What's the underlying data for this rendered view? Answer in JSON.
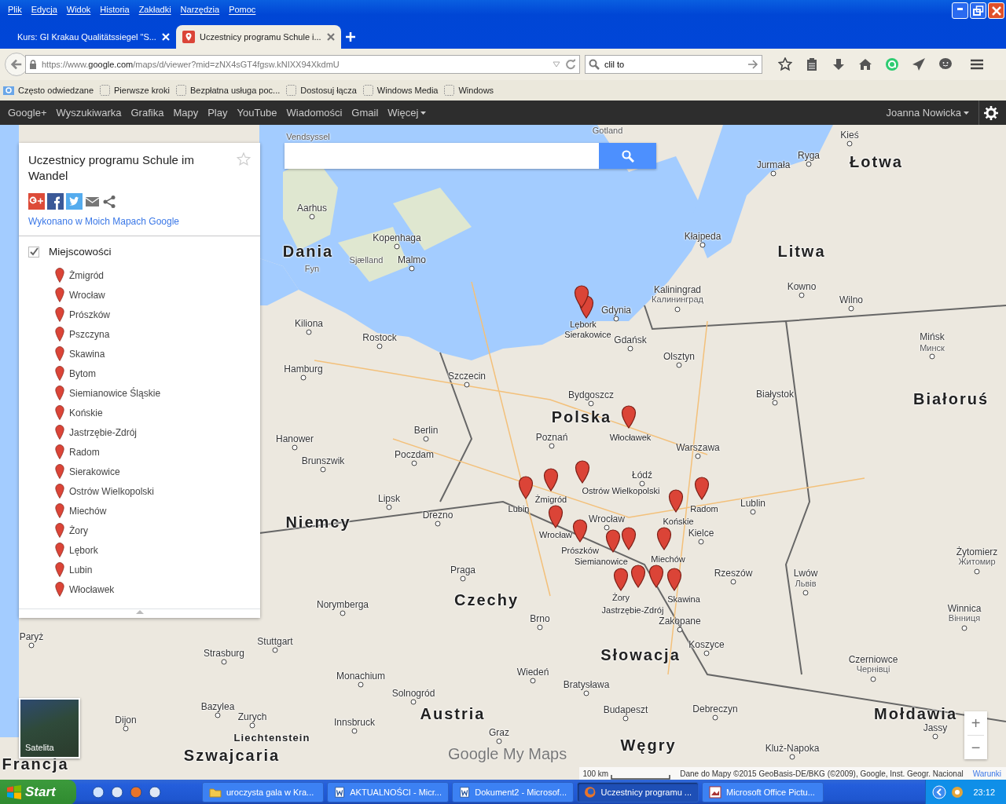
{
  "menu_bar": [
    "Plik",
    "Edycja",
    "Widok",
    "Historia",
    "Zakładki",
    "Narzędzia",
    "Pomoc"
  ],
  "tabs": [
    {
      "title": "Kurs: GI Krakau Qualitätssiegel \"S...",
      "selected": false
    },
    {
      "title": "Uczestnicy programu Schule i...",
      "selected": true
    }
  ],
  "address_bar": {
    "url": "https://www.**google.com**/maps/d/viewer?mid=zNX4sGT4fgsw.kNIXX94XkdmU"
  },
  "search_bar": {
    "value": "clil to"
  },
  "bookmarks": [
    "Często odwiedzane",
    "Pierwsze kroki",
    "Bezpłatna usługa poc...",
    "Dostosuj łącza",
    "Windows Media",
    "Windows"
  ],
  "google_bar": {
    "links": [
      "Google+",
      "Wyszukiwarka",
      "Grafika",
      "Mapy",
      "Play",
      "YouTube",
      "Wiadomości",
      "Gmail"
    ],
    "more": "Więcej",
    "user": "Joanna Nowicka"
  },
  "panel": {
    "title": "Uczestnicy programu Schule im Wandel",
    "starred": false,
    "made_with": "Wykonano w Moich Mapach Google",
    "layer": {
      "name": "Miejscowości",
      "checked": true,
      "places": [
        "Żmigród",
        "Wrocław",
        "Prószków",
        "Pszczyna",
        "Skawina",
        "Bytom",
        "Siemianowice Śląskie",
        "Końskie",
        "Jastrzębie-Zdrój",
        "Radom",
        "Sierakowice",
        "Ostrów Wielkopolski",
        "Miechów",
        "Żory",
        "Lębork",
        "Lubin",
        "Włocławek"
      ]
    }
  },
  "map": {
    "labels": [
      {
        "text": "Łotwa",
        "kind": "country"
      },
      {
        "text": "Dania",
        "kind": "country"
      },
      {
        "text": "Litwa",
        "kind": "country"
      },
      {
        "text": "Polska",
        "kind": "country"
      },
      {
        "text": "Białoruś",
        "kind": "country"
      },
      {
        "text": "Niemcy",
        "kind": "country"
      },
      {
        "text": "Czechy",
        "kind": "country"
      },
      {
        "text": "Słowacja",
        "kind": "country"
      },
      {
        "text": "Austria",
        "kind": "country"
      },
      {
        "text": "Węgry",
        "kind": "country"
      },
      {
        "text": "Szwajcaria",
        "kind": "country"
      },
      {
        "text": "Francja",
        "kind": "country"
      },
      {
        "text": "Liechtenstein",
        "kind": "state"
      },
      {
        "text": "Mołdawia",
        "kind": "country"
      },
      {
        "text": "Gotland",
        "kind": "region"
      },
      {
        "text": "Vendsyssel",
        "kind": "region"
      },
      {
        "text": "Kieś",
        "kind": "city"
      },
      {
        "text": "Ryga",
        "kind": "city"
      },
      {
        "text": "Jurmała",
        "kind": "city"
      },
      {
        "text": "Aarhus",
        "kind": "city"
      },
      {
        "text": "Kopenhaga",
        "kind": "city"
      },
      {
        "text": "Kłajpeda",
        "kind": "city"
      },
      {
        "text": "Sjælland",
        "kind": "region"
      },
      {
        "text": "Malmo",
        "kind": "city"
      },
      {
        "text": "Fyn",
        "kind": "region"
      },
      {
        "text": "Kaliningrad",
        "kind": "city"
      },
      {
        "text": "Калининград",
        "kind": "region"
      },
      {
        "text": "Kowno",
        "kind": "city"
      },
      {
        "text": "Wilno",
        "kind": "city"
      },
      {
        "text": "Gdynia",
        "kind": "city"
      },
      {
        "text": "Kiliona",
        "kind": "city"
      },
      {
        "text": "Rostock",
        "kind": "city"
      },
      {
        "text": "Gdańsk",
        "kind": "city"
      },
      {
        "text": "Mińsk",
        "kind": "city"
      },
      {
        "text": "Минск",
        "kind": "region"
      },
      {
        "text": "Olsztyn",
        "kind": "city"
      },
      {
        "text": "Hamburg",
        "kind": "city"
      },
      {
        "text": "Szczecin",
        "kind": "city"
      },
      {
        "text": "Bydgoszcz",
        "kind": "city"
      },
      {
        "text": "Białystok",
        "kind": "city"
      },
      {
        "text": "Berlin",
        "kind": "city"
      },
      {
        "text": "Poznań",
        "kind": "city"
      },
      {
        "text": "Hanower",
        "kind": "city"
      },
      {
        "text": "Warszawa",
        "kind": "city"
      },
      {
        "text": "Poczdam",
        "kind": "city"
      },
      {
        "text": "Brunszwik",
        "kind": "city"
      },
      {
        "text": "Łódź",
        "kind": "city"
      },
      {
        "text": "Lipsk",
        "kind": "city"
      },
      {
        "text": "Lublin",
        "kind": "city"
      },
      {
        "text": "Drezno",
        "kind": "city"
      },
      {
        "text": "Kielce",
        "kind": "city"
      },
      {
        "text": "Wrocław",
        "kind": "city"
      },
      {
        "text": "Żytomierz",
        "kind": "city"
      },
      {
        "text": "Житомир",
        "kind": "region"
      },
      {
        "text": "Praga",
        "kind": "city"
      },
      {
        "text": "Rzeszów",
        "kind": "city"
      },
      {
        "text": "Lwów",
        "kind": "city"
      },
      {
        "text": "Львів",
        "kind": "region"
      },
      {
        "text": "Norymberga",
        "kind": "city"
      },
      {
        "text": "Winnica",
        "kind": "city"
      },
      {
        "text": "Brno",
        "kind": "city"
      },
      {
        "text": "Zakopane",
        "kind": "city"
      },
      {
        "text": "Вінниця",
        "kind": "region"
      },
      {
        "text": "Paryż",
        "kind": "city"
      },
      {
        "text": "Stuttgart",
        "kind": "city"
      },
      {
        "text": "Koszyce",
        "kind": "city"
      },
      {
        "text": "Strasburg",
        "kind": "city"
      },
      {
        "text": "Czerniowce",
        "kind": "city"
      },
      {
        "text": "Чернівці",
        "kind": "region"
      },
      {
        "text": "Wiedeń",
        "kind": "city"
      },
      {
        "text": "Monachium",
        "kind": "city"
      },
      {
        "text": "Bratysława",
        "kind": "city"
      },
      {
        "text": "Solnogród",
        "kind": "city"
      },
      {
        "text": "Bazylea",
        "kind": "city"
      },
      {
        "text": "Budapeszt",
        "kind": "city"
      },
      {
        "text": "Debreczyn",
        "kind": "city"
      },
      {
        "text": "Dijon",
        "kind": "city"
      },
      {
        "text": "Zurych",
        "kind": "city"
      },
      {
        "text": "Innsbruck",
        "kind": "city"
      },
      {
        "text": "Graz",
        "kind": "city"
      },
      {
        "text": "Jassy",
        "kind": "city"
      },
      {
        "text": "Kluż-Napoka",
        "kind": "city"
      }
    ],
    "markers": [
      {
        "kind": "pin",
        "label": "Żmigród"
      },
      {
        "kind": "pin",
        "label": "Wrocław"
      },
      {
        "kind": "pin",
        "label": "Prószków"
      },
      {
        "kind": "pin"
      },
      {
        "kind": "pin",
        "label": "Skawina"
      },
      {
        "kind": "pin"
      },
      {
        "kind": "pin",
        "label": "Siemianowice"
      },
      {
        "kind": "pin",
        "label": "Końskie"
      },
      {
        "kind": "pin",
        "label": "Jastrzębie-Zdrój"
      },
      {
        "kind": "pin",
        "label": "Radom"
      },
      {
        "kind": "pin",
        "label": "Sierakowice"
      },
      {
        "kind": "pin",
        "label": "Ostrów Wielkopolski"
      },
      {
        "kind": "pin",
        "label": "Miechów"
      },
      {
        "kind": "pin",
        "label": "Żory"
      },
      {
        "kind": "pin",
        "label": "Lębork"
      },
      {
        "kind": "pin",
        "label": "Lubin"
      },
      {
        "kind": "pin",
        "label": "Włocławek"
      }
    ],
    "satellite": "Satelita",
    "logo": "Google My Maps",
    "zoom_in": "+",
    "zoom_out": "−",
    "scale": "100 km",
    "attribution": "Dane do Mapy ©2015 GeoBasis-DE/BKG (©2009), Google, Inst. Geogr. Nacional",
    "terms": "Warunki"
  },
  "taskbar": {
    "start": "Start",
    "windows": [
      {
        "title": "uroczysta gala w Kra...",
        "kind": "folder",
        "selected": false
      },
      {
        "title": "AKTUALNOŚCI - Micr...",
        "kind": "document",
        "selected": false
      },
      {
        "title": "Dokument2 - Microsof...",
        "kind": "document",
        "selected": false
      },
      {
        "title": "Uczestnicy programu ...",
        "kind": "browser",
        "selected": true
      },
      {
        "title": "Microsoft Office Pictu...",
        "kind": "picture",
        "selected": false
      }
    ],
    "clock": "23:12"
  }
}
